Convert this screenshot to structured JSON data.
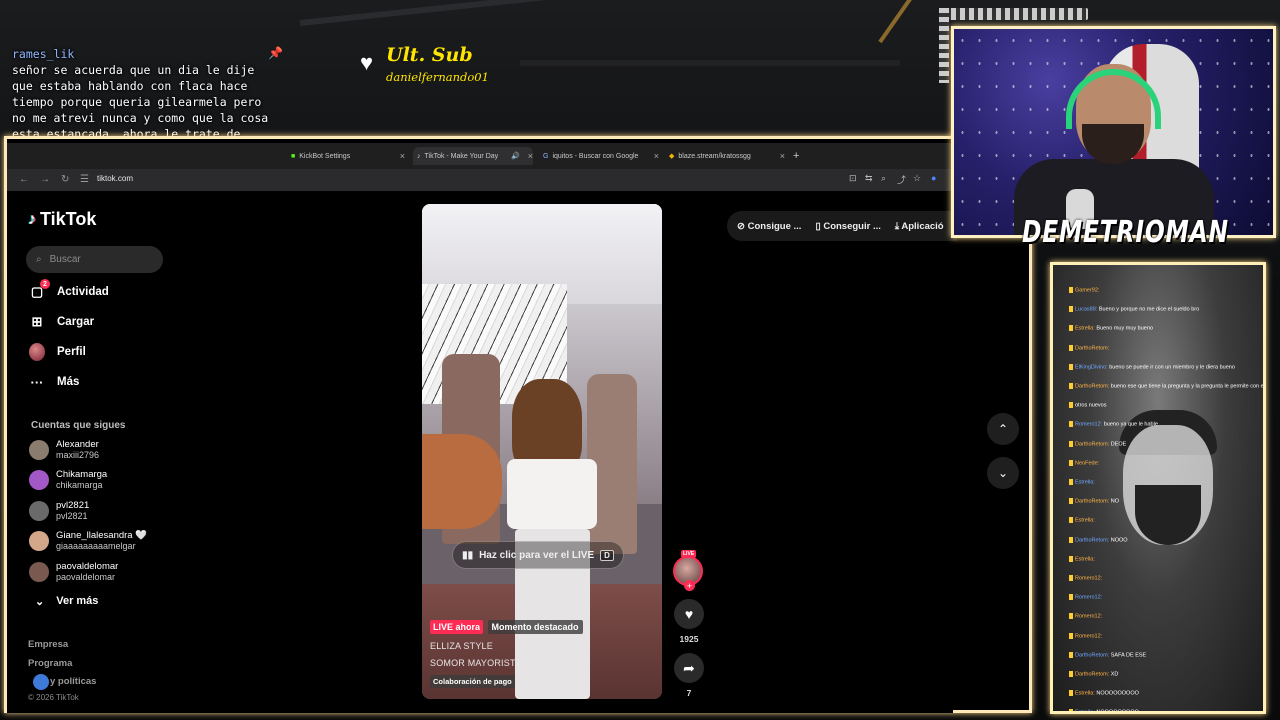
{
  "overlay_chat": {
    "username": "rames_lik",
    "message": "señor se acuerda que un dia le dije que estaba hablando con flaca hace tiempo porque queria gilearmela pero no me atrevi nunca y como que la cosa esta estancada, ahora le trate de hablar con mas intencion pero aun no"
  },
  "last_sub": {
    "title": "Ult. Sub",
    "name": "danielfernando01"
  },
  "browser": {
    "tabs": [
      {
        "label": "KickBot Settings",
        "active": false
      },
      {
        "label": "TikTok - Make Your Day",
        "active": true
      },
      {
        "label": "iquitos - Buscar con Google",
        "active": false
      },
      {
        "label": "blaze.stream/kratossgg",
        "active": false
      }
    ],
    "new_tab": "+",
    "url": "tiktok.com"
  },
  "tiktok": {
    "logo": "TikTok",
    "search_placeholder": "Buscar",
    "nav": [
      {
        "label": "Actividad",
        "icon": "inbox-icon",
        "badge": "2"
      },
      {
        "label": "Cargar",
        "icon": "upload-icon"
      },
      {
        "label": "Perfil",
        "icon": "profile-icon"
      },
      {
        "label": "Más",
        "icon": "more-icon"
      }
    ],
    "following_title": "Cuentas que sigues",
    "following": [
      {
        "name": "Alexander",
        "handle": "maxiii2796",
        "color": "#8a7c6e"
      },
      {
        "name": "Chikamarga",
        "handle": "chikamarga",
        "color": "#a259c7"
      },
      {
        "name": "pvl2821",
        "handle": "pvl2821",
        "color": "#6a6a6a"
      },
      {
        "name": "Giane_llalesandra 🤍",
        "handle": "giaaaaaaaaamelgar",
        "color": "#d4a78a"
      },
      {
        "name": "paovaldelomar",
        "handle": "paovaldelomar",
        "color": "#7a5a50"
      }
    ],
    "see_more": "Ver más",
    "footer": [
      "Empresa",
      "Programa",
      "y políticas"
    ],
    "copyright": "© 2026 TikTok",
    "top_actions": [
      "Consigue ...",
      "Conseguir ...",
      "Aplicació"
    ],
    "video": {
      "live_pill": "Haz clic para ver el LIVE",
      "live_key": "D",
      "tag_live": "LIVE ahora",
      "tag_moment": "Momento destacado",
      "line1": "ELLIZA STYLE",
      "line2": "SOMOR MAYORISTA",
      "collab": "Colaboración de pago",
      "live_badge": "LIVE",
      "likes": "1925",
      "shares": "7"
    }
  },
  "streamer": {
    "name": "DEMETRIOMAN"
  },
  "stream_chat": [
    {
      "user": "Gamer92",
      "text": ""
    },
    {
      "user": "Lucas88",
      "text": "Bueno y porque no me dice el sueldo bro"
    },
    {
      "user": "Estrella",
      "text": "Bueno muy muy bueno"
    },
    {
      "user": "DarthoRetom",
      "text": ""
    },
    {
      "user": "ElKingDivino",
      "text": "bueno se puede ir con un miembro y le diera bueno"
    },
    {
      "user": "DarthoRetom",
      "text": "bueno ese que tiene la pregunta y la pregunta le permite con el modo y a ver si se lo"
    },
    {
      "user": "",
      "text": "otros nuevos"
    },
    {
      "user": "Romero12",
      "text": "bueno ya que le hable"
    },
    {
      "user": "DarthoRetom",
      "text": "DEOE"
    },
    {
      "user": "NeoFede",
      "text": ""
    },
    {
      "user": "Estrella",
      "text": ""
    },
    {
      "user": "DarthoRetom",
      "text": "NO"
    },
    {
      "user": "Estrella",
      "text": ""
    },
    {
      "user": "DarthoRetom",
      "text": "NOOO"
    },
    {
      "user": "Estrella",
      "text": ""
    },
    {
      "user": "Romero12",
      "text": ""
    },
    {
      "user": "Romero12",
      "text": ""
    },
    {
      "user": "Romero12",
      "text": ""
    },
    {
      "user": "Romero12",
      "text": ""
    },
    {
      "user": "DarthoRetom",
      "text": "SAFA DE ESE"
    },
    {
      "user": "DarthoRetom",
      "text": "XD"
    },
    {
      "user": "Estrella",
      "text": "NOOOOOOOOO"
    },
    {
      "user": "Estrella",
      "text": "NOOOOOOOOO"
    }
  ]
}
